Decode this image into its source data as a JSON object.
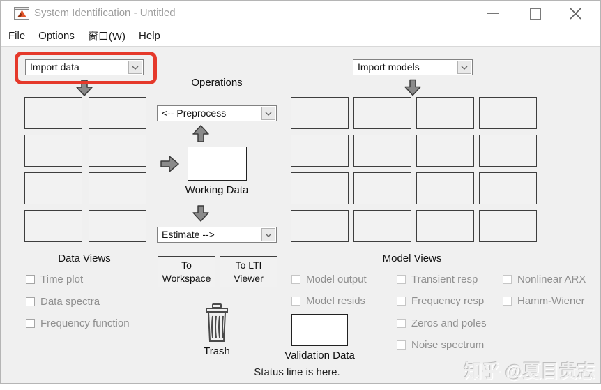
{
  "window": {
    "title": "System Identification - Untitled"
  },
  "menu": {
    "items": [
      {
        "label": "File"
      },
      {
        "label": "Options"
      },
      {
        "label": "窗口(W)"
      },
      {
        "label": "Help"
      }
    ]
  },
  "data_panel": {
    "import_dropdown_value": "Import data",
    "views_label": "Data Views",
    "checkboxes": [
      {
        "label": "Time plot",
        "checked": false
      },
      {
        "label": "Data spectra",
        "checked": false
      },
      {
        "label": "Frequency function",
        "checked": false
      }
    ]
  },
  "operations": {
    "label": "Operations",
    "preprocess_dropdown_value": "<-- Preprocess",
    "working_data_label": "Working Data",
    "estimate_dropdown_value": "Estimate -->",
    "to_workspace_button": "To Workspace",
    "to_lti_viewer_button": "To LTI Viewer",
    "trash_label": "Trash",
    "validation_data_label": "Validation Data"
  },
  "model_panel": {
    "import_dropdown_value": "Import models",
    "views_label": "Model Views",
    "checkbox_columns": [
      {
        "items": [
          {
            "label": "Model output",
            "checked": false
          },
          {
            "label": "Model resids",
            "checked": false
          }
        ]
      },
      {
        "items": [
          {
            "label": "Transient resp",
            "checked": false
          },
          {
            "label": "Frequency resp",
            "checked": false
          },
          {
            "label": "Zeros and poles",
            "checked": false
          },
          {
            "label": "Noise spectrum",
            "checked": false
          }
        ]
      },
      {
        "items": [
          {
            "label": "Nonlinear ARX",
            "checked": false
          },
          {
            "label": "Hamm-Wiener",
            "checked": false
          }
        ]
      }
    ]
  },
  "status_line": "Status line is here.",
  "watermark": "知乎 @夏目贵志",
  "colors": {
    "highlight_red": "#e5392b",
    "matlab_orange": "#e2552a",
    "background": "#f0f0f0"
  }
}
